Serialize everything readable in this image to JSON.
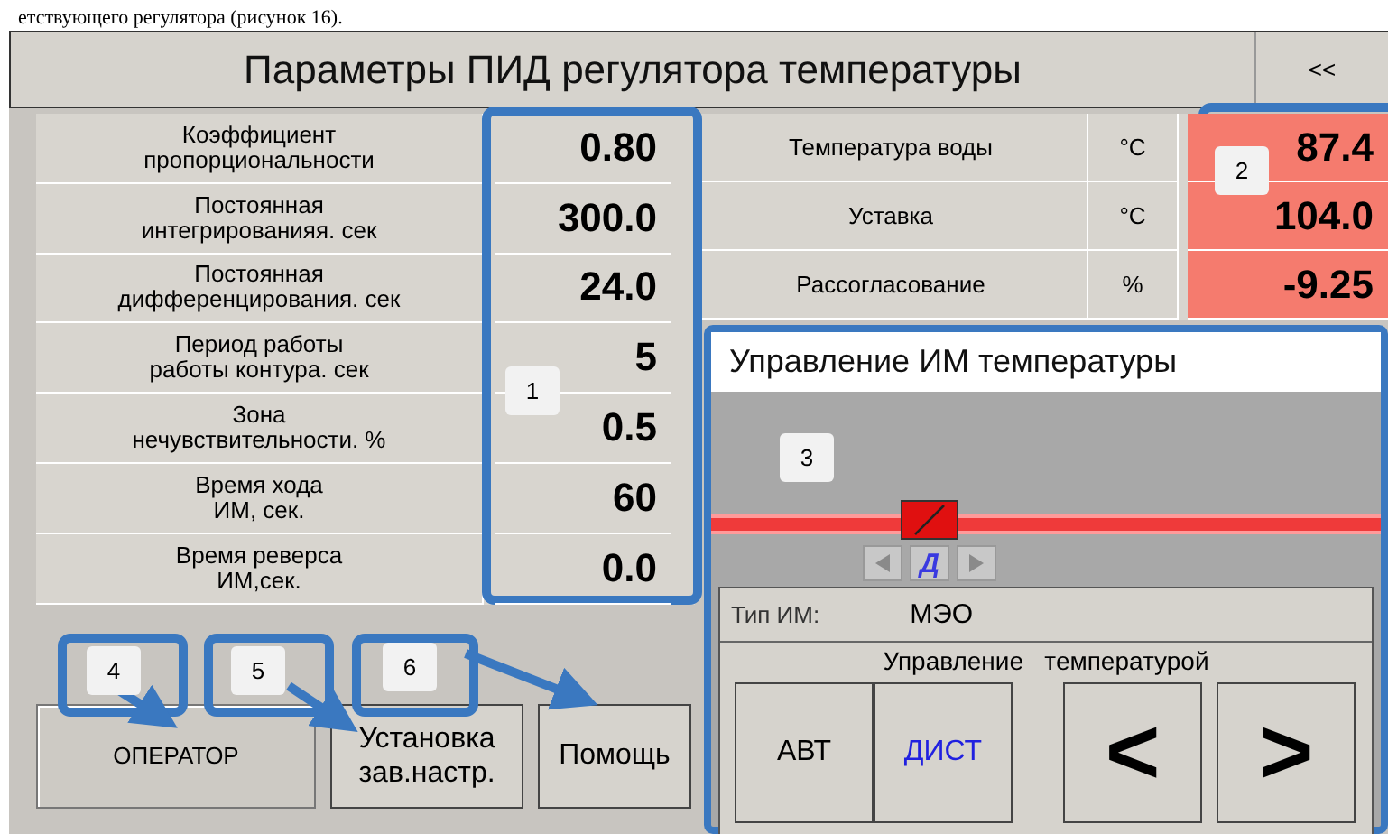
{
  "document_text": "етствующего регулятора (рисунок 16).",
  "window": {
    "title": "Параметры ПИД регулятора температуры",
    "back_button": "<<"
  },
  "parameters": [
    {
      "label": "Коэффициент\nпропорциональности",
      "value": "0.80"
    },
    {
      "label": "Постоянная\nинтегрированияя. сек",
      "value": "300.0"
    },
    {
      "label": "Постоянная\nдифференцирования. сек",
      "value": "24.0"
    },
    {
      "label": "Период работы\nработы контура. сек",
      "value": "5"
    },
    {
      "label": "Зона\nнечувствительности. %",
      "value": "0.5"
    },
    {
      "label": "Время хода\nИМ, сек.",
      "value": "60"
    },
    {
      "label": "Время реверса\nИМ,сек.",
      "value": "0.0"
    }
  ],
  "readings": [
    {
      "label": "Температура воды",
      "unit": "°C",
      "value": "87.4",
      "alarm": true
    },
    {
      "label": "Уставка",
      "unit": "°C",
      "value": "104.0",
      "alarm": true
    },
    {
      "label": "Рассогласование",
      "unit": "%",
      "value": "-9.25",
      "alarm": true
    }
  ],
  "buttons": [
    {
      "label": "ОПЕРАТОР",
      "pressed": true
    },
    {
      "label": "Установка зав.настр.",
      "pressed": false
    },
    {
      "label": "Помощь",
      "pressed": false
    }
  ],
  "actuator_window": {
    "title": "Управление ИМ температуры",
    "valve": {
      "alarm": true
    },
    "jog": {
      "left_disabled": true,
      "label": "Д",
      "right_disabled": true
    },
    "type_label": "Тип ИМ:",
    "type_value": "МЭО",
    "control_title": "Управление   температурой",
    "modes": [
      {
        "label": "АВТ",
        "selected": false
      },
      {
        "label": "ДИСТ",
        "selected": true
      }
    ],
    "steps": [
      {
        "label": "<"
      },
      {
        "label": ">"
      }
    ]
  },
  "annotations": [
    {
      "label": "1"
    },
    {
      "label": "2"
    },
    {
      "label": "3"
    },
    {
      "label": "4"
    },
    {
      "label": "5"
    },
    {
      "label": "6"
    }
  ]
}
